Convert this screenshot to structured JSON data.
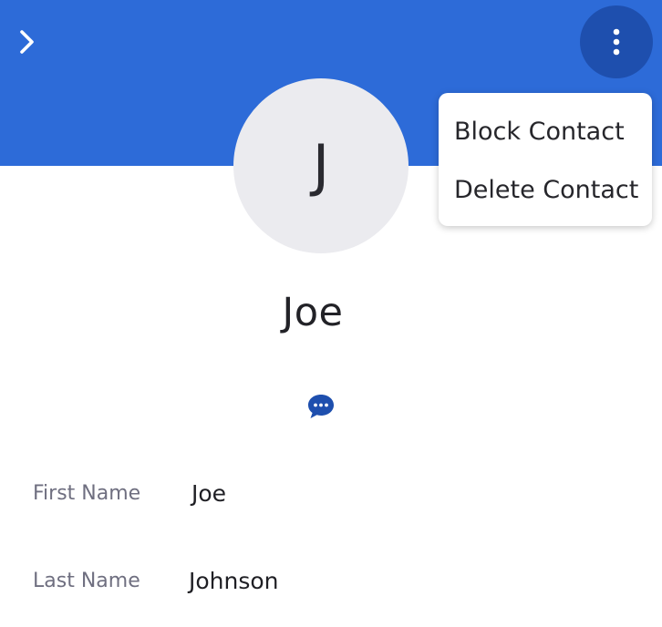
{
  "colors": {
    "header_background": "#2d6bd8",
    "more_button_background": "#1e4fae",
    "avatar_background": "#ebebef",
    "accent_icon": "#1e4fae"
  },
  "header": {
    "back_icon": "chevron-right-icon",
    "more_icon": "vertical-dots-icon"
  },
  "avatar": {
    "initial": "J"
  },
  "menu": {
    "items": [
      {
        "label": "Block Contact"
      },
      {
        "label": "Delete Contact"
      }
    ]
  },
  "contact": {
    "display_name": "Joe",
    "message_icon": "chat-bubble-icon"
  },
  "fields": [
    {
      "label": "First Name",
      "value": "Joe"
    },
    {
      "label": "Last Name",
      "value": "Johnson"
    }
  ]
}
